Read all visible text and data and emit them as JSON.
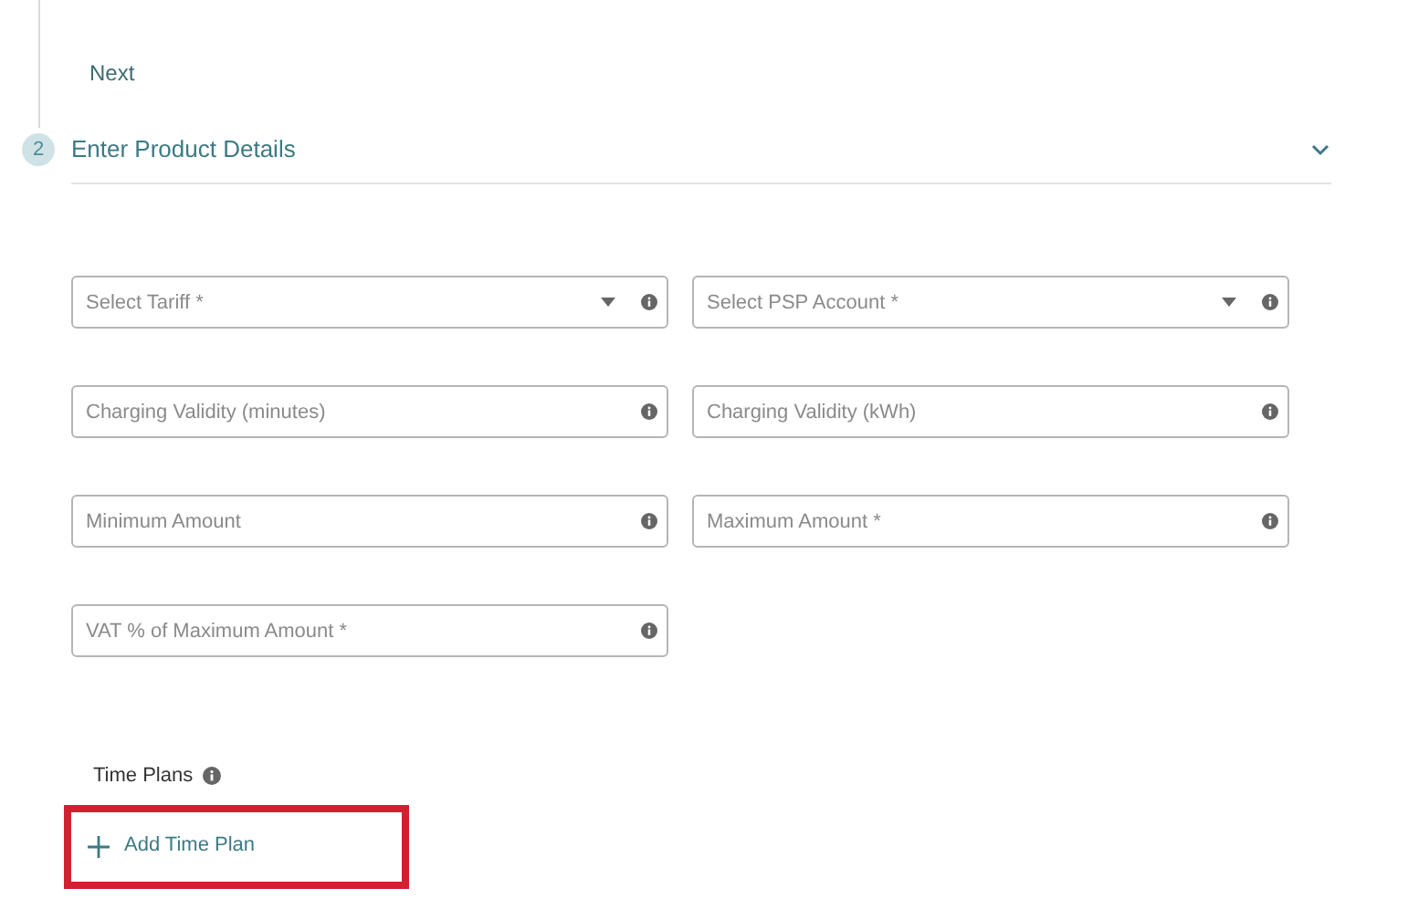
{
  "next_button": {
    "label": "Next"
  },
  "step": {
    "number": "2",
    "title": "Enter Product Details",
    "expanded": true
  },
  "fields": [
    {
      "kind": "select",
      "placeholder": "Select Tariff *"
    },
    {
      "kind": "select",
      "placeholder": "Select PSP Account *"
    },
    {
      "kind": "text",
      "placeholder": "Charging Validity (minutes)"
    },
    {
      "kind": "text",
      "placeholder": "Charging Validity (kWh)"
    },
    {
      "kind": "text",
      "placeholder": "Minimum Amount"
    },
    {
      "kind": "text",
      "placeholder": "Maximum Amount *"
    },
    {
      "kind": "text",
      "placeholder": "VAT % of Maximum Amount *"
    }
  ],
  "time_plans": {
    "label": "Time Plans",
    "add_button": {
      "label": "Add Time Plan",
      "highlighted": true
    }
  }
}
